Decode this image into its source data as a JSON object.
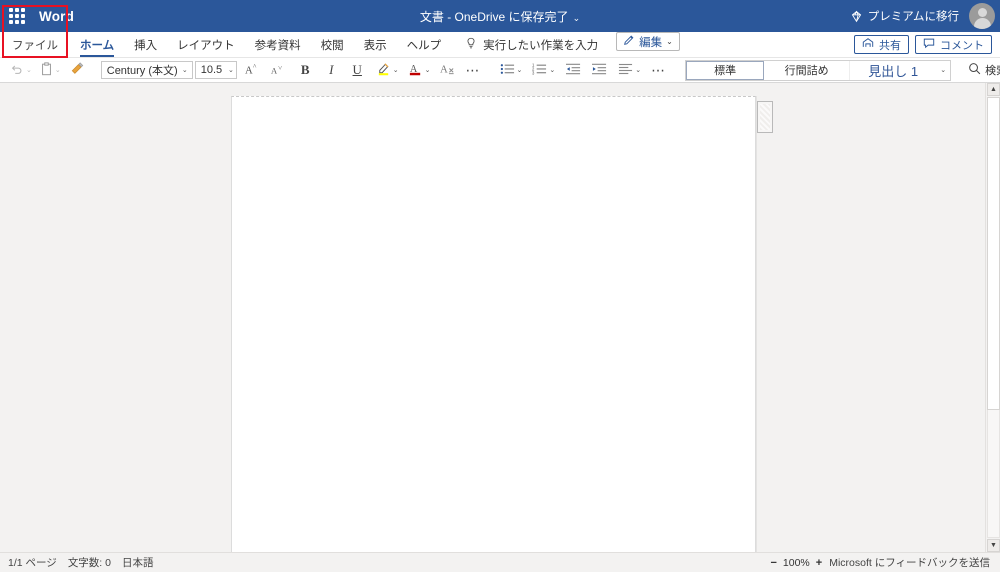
{
  "titlebar": {
    "waffle_icon": "app-launcher-icon",
    "app_name": "Word",
    "document_title": "文書 - OneDrive に保存完了",
    "title_chevron": "⌄",
    "premium_label": "プレミアムに移行",
    "premium_icon": "diamond-icon",
    "avatar_icon": "account-avatar",
    "brand_color": "#2b579a"
  },
  "tabs": [
    {
      "label": "ファイル",
      "active": false,
      "highlighted": true
    },
    {
      "label": "ホーム",
      "active": true,
      "highlighted": false
    },
    {
      "label": "挿入",
      "active": false,
      "highlighted": false
    },
    {
      "label": "レイアウト",
      "active": false,
      "highlighted": false
    },
    {
      "label": "参考資料",
      "active": false,
      "highlighted": false
    },
    {
      "label": "校閲",
      "active": false,
      "highlighted": false
    },
    {
      "label": "表示",
      "active": false,
      "highlighted": false
    },
    {
      "label": "ヘルプ",
      "active": false,
      "highlighted": false
    }
  ],
  "tellme": {
    "icon": "lightbulb-icon",
    "placeholder": "実行したい作業を入力"
  },
  "edit_button": {
    "icon": "pencil-icon",
    "label": "編集",
    "chevron": "⌄"
  },
  "tabbar_right": {
    "share_icon": "share-icon",
    "share_label": "共有",
    "comment_icon": "comment-icon",
    "comment_label": "コメント"
  },
  "ribbon": {
    "undo_icon": "undo-icon",
    "paste_icon": "clipboard-paste-icon",
    "format_painter_icon": "format-painter-icon",
    "font_name": "Century (本文)",
    "font_size": "10.5",
    "grow_font_icon": "grow-font-icon",
    "shrink_font_icon": "shrink-font-icon",
    "bold_label": "B",
    "italic_label": "I",
    "underline_label": "U",
    "highlight_icon": "text-highlight-icon",
    "highlight_color": "#ffff00",
    "font_color_icon": "font-color-icon",
    "font_color": "#c00000",
    "clear_formatting_icon": "clear-formatting-icon",
    "font_more_icon": "more-ellipsis-icon",
    "bullets_icon": "bullet-list-icon",
    "numbering_icon": "numbered-list-icon",
    "decrease_indent_icon": "decrease-indent-icon",
    "increase_indent_icon": "increase-indent-icon",
    "align_icon": "align-left-icon",
    "paragraph_more_icon": "more-ellipsis-icon",
    "chevron": "⌄",
    "collapse_icon": "chevron-down-icon",
    "styles": [
      {
        "label": "標準",
        "selected": true
      },
      {
        "label": "行間詰め",
        "selected": false
      },
      {
        "label": "見出し 1",
        "selected": false
      }
    ],
    "find_icon": "search-icon",
    "find_label": "検索"
  },
  "canvas": {
    "page_name": "document-page",
    "handle_name": "page-side-handle"
  },
  "scrollbar": {
    "up_arrow": "▲",
    "down_arrow": "▼"
  },
  "statusbar": {
    "page_count": "1/1 ページ",
    "word_count": "文字数: 0",
    "language": "日本語",
    "zoom_out": "−",
    "zoom_level": "100%",
    "zoom_in": "+",
    "feedback": "Microsoft にフィードバックを送信"
  }
}
